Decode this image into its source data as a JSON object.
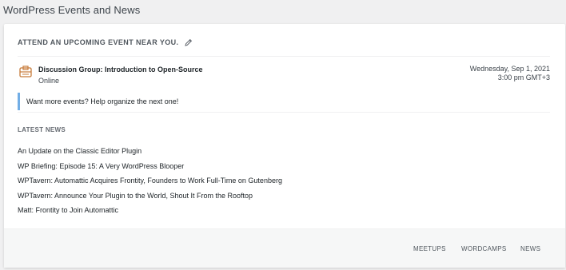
{
  "page": {
    "title": "WordPress Events and News"
  },
  "events": {
    "heading": "ATTEND AN UPCOMING EVENT NEAR YOU.",
    "edit_icon": "pencil-icon",
    "item": {
      "icon": "meetup-icon",
      "title": "Discussion Group: Introduction to Open-Source",
      "location": "Online",
      "date": "Wednesday, Sep 1, 2021",
      "time": "3:00 pm GMT+3"
    },
    "notice": "Want more events? Help organize the next one!"
  },
  "news": {
    "heading": "LATEST NEWS",
    "items": [
      "An Update on the Classic Editor Plugin",
      "WP Briefing: Episode 15: A Very WordPress Blooper",
      "WPTavern: Automattic Acquires Frontity, Founders to Work Full-Time on Gutenberg",
      "WPTavern: Announce Your Plugin to the World, Shout It From the Rooftop",
      "Matt: Frontity to Join Automattic"
    ]
  },
  "footer": {
    "links": [
      "MEETUPS",
      "WORDCAMPS",
      "NEWS"
    ]
  },
  "colors": {
    "accent": "#72aee6",
    "icon": "#c77b3a"
  }
}
